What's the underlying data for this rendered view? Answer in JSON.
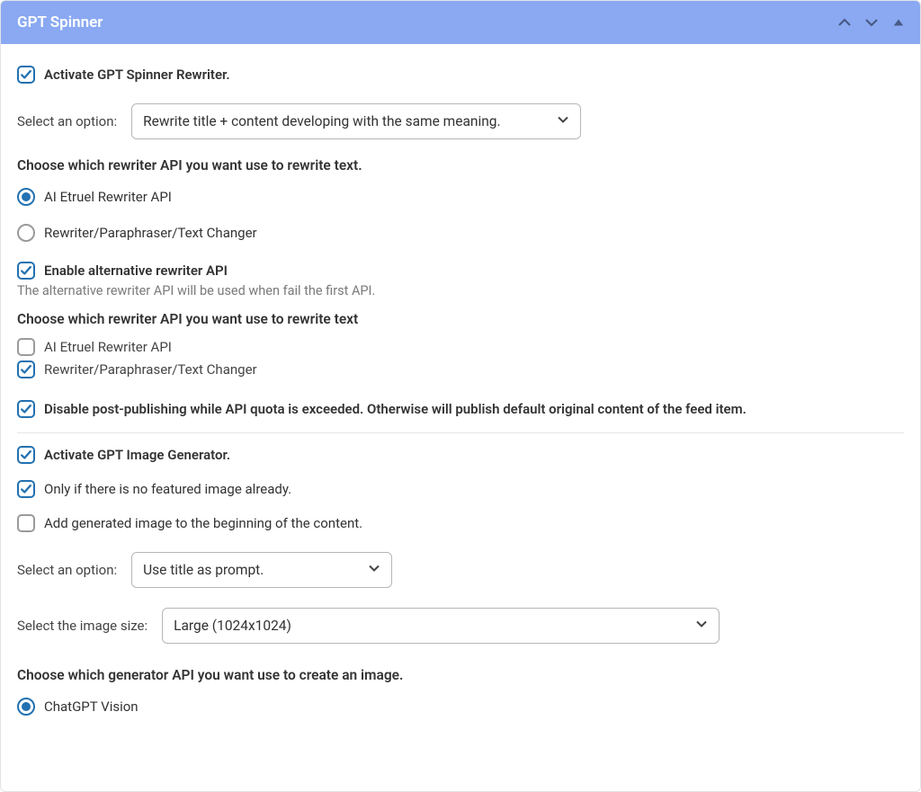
{
  "header": {
    "title": "GPT Spinner"
  },
  "body": {
    "activate_rewriter_label": "Activate GPT Spinner Rewriter.",
    "select_option_label": "Select an option:",
    "rewrite_mode_selected": "Rewrite title + content developing with the same meaning.",
    "choose_rewriter_api_heading": "Choose which rewriter API you want use to rewrite text.",
    "api_radio": {
      "option1": "AI Etruel Rewriter API",
      "option2": "Rewriter/Paraphraser/Text Changer"
    },
    "enable_alt_api_label": "Enable alternative rewriter API",
    "alt_api_desc": "The alternative rewriter API will be used when fail the first API.",
    "choose_alt_api_heading": "Choose which rewriter API you want use to rewrite text",
    "alt_api_check": {
      "option1": "AI Etruel Rewriter API",
      "option2": "Rewriter/Paraphraser/Text Changer"
    },
    "disable_publish_label": "Disable post-publishing while API quota is exceeded. Otherwise will publish default original content of the feed item.",
    "activate_image_generator_label": "Activate GPT Image Generator.",
    "only_if_no_featured_label": "Only if there is no featured image already.",
    "add_generated_to_beginning_label": "Add generated image to the beginning of the content.",
    "image_prompt_selected": "Use title as prompt.",
    "select_image_size_label": "Select the image size:",
    "image_size_selected": "Large (1024x1024)",
    "choose_generator_api_heading": "Choose which generator API you want use to create an image.",
    "generator_api_radio": {
      "option1": "ChatGPT Vision"
    }
  }
}
